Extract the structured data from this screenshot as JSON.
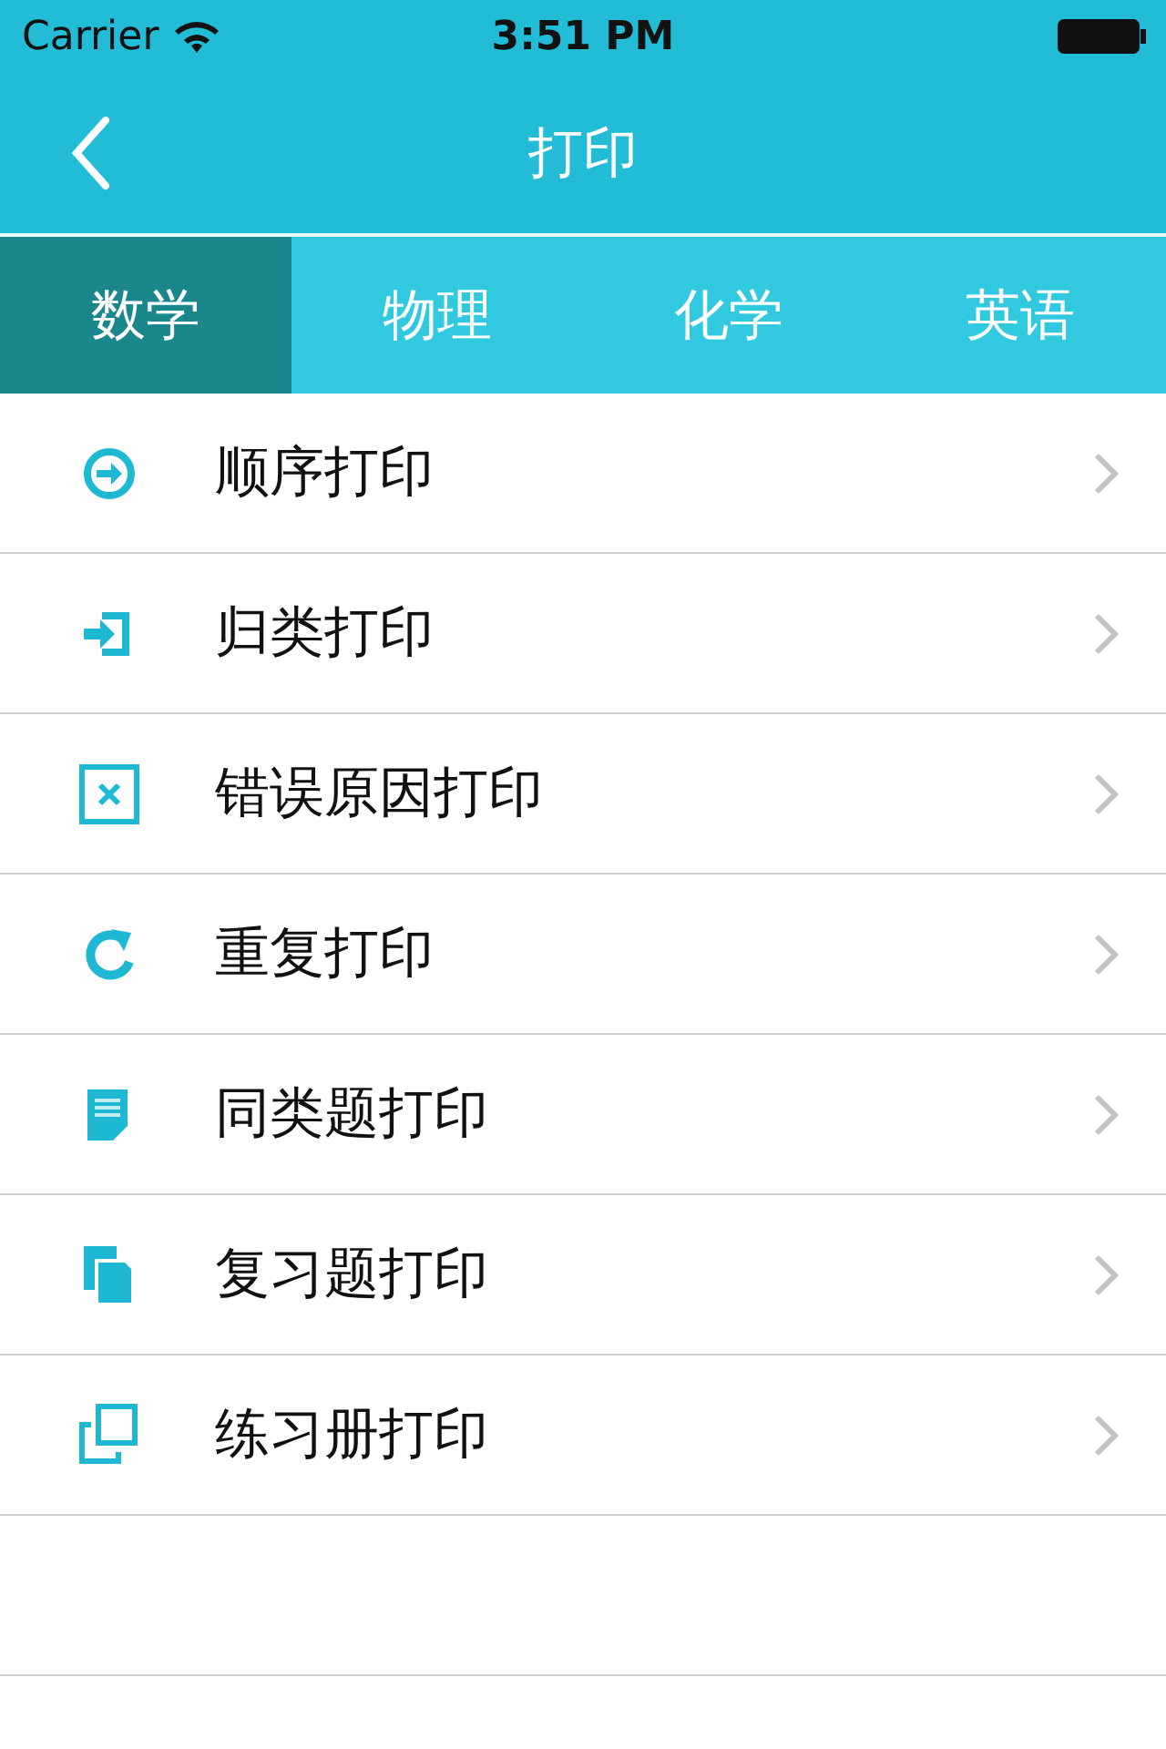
{
  "status_bar": {
    "carrier": "Carrier",
    "time": "3:51 PM"
  },
  "nav": {
    "title": "打印"
  },
  "tabs": [
    {
      "label": "数学",
      "selected": true
    },
    {
      "label": "物理",
      "selected": false
    },
    {
      "label": "化学",
      "selected": false
    },
    {
      "label": "英语",
      "selected": false
    }
  ],
  "items": [
    {
      "label": "顺序打印",
      "kind": "circle-arrow"
    },
    {
      "label": "归类打印",
      "kind": "enter"
    },
    {
      "label": "错误原因打印",
      "kind": "cross"
    },
    {
      "label": "重复打印",
      "kind": "refresh"
    },
    {
      "label": "同类题打印",
      "kind": "note"
    },
    {
      "label": "复习题打印",
      "kind": "copies"
    },
    {
      "label": "练习册打印",
      "kind": "frames"
    }
  ]
}
